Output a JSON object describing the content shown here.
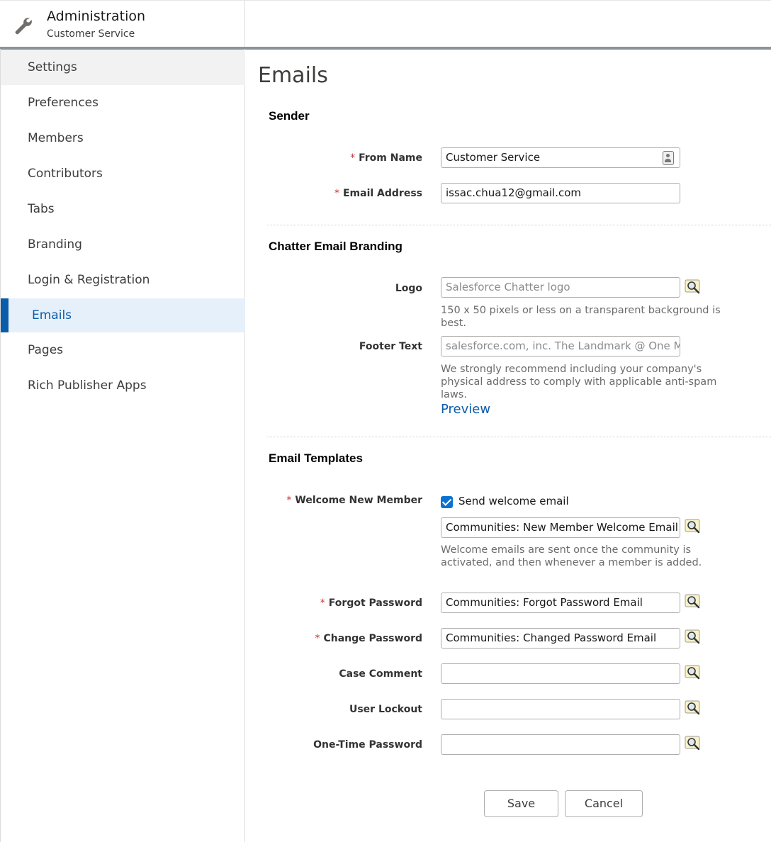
{
  "header": {
    "title": "Administration",
    "subtitle": "Customer Service"
  },
  "sidebar": {
    "items": [
      {
        "label": "Settings"
      },
      {
        "label": "Preferences"
      },
      {
        "label": "Members"
      },
      {
        "label": "Contributors"
      },
      {
        "label": "Tabs"
      },
      {
        "label": "Branding"
      },
      {
        "label": "Login & Registration"
      },
      {
        "label": "Emails"
      },
      {
        "label": "Pages"
      },
      {
        "label": "Rich Publisher Apps"
      }
    ],
    "active": "Emails"
  },
  "main": {
    "title": "Emails",
    "sender": {
      "title": "Sender",
      "from_name_label": "From Name",
      "from_name_value": "Customer Service",
      "email_label": "Email Address",
      "email_value": "issac.chua12@gmail.com"
    },
    "branding": {
      "title": "Chatter Email Branding",
      "logo_label": "Logo",
      "logo_placeholder": "Salesforce Chatter logo",
      "logo_hint": "150 x 50 pixels or less on a transparent background is best.",
      "footer_label": "Footer Text",
      "footer_placeholder": "salesforce.com, inc. The Landmark @ One Mark",
      "footer_hint": "We strongly recommend including your company's physical address to comply with applicable anti-spam laws.",
      "preview_label": "Preview"
    },
    "templates": {
      "title": "Email Templates",
      "welcome_label": "Welcome New Member",
      "welcome_checkbox_label": "Send welcome email",
      "welcome_checked": true,
      "welcome_value": "Communities: New Member Welcome Email",
      "welcome_hint": "Welcome emails are sent once the community is activated, and then whenever a member is added.",
      "forgot_label": "Forgot Password",
      "forgot_value": "Communities: Forgot Password Email",
      "change_label": "Change Password",
      "change_value": "Communities: Changed Password Email",
      "case_label": "Case Comment",
      "case_value": "",
      "lockout_label": "User Lockout",
      "lockout_value": "",
      "otp_label": "One-Time Password",
      "otp_value": ""
    },
    "required_marker": "*",
    "buttons": {
      "save": "Save",
      "cancel": "Cancel"
    }
  },
  "colors": {
    "accent": "#0b5cab",
    "required": "#c23934",
    "active_nav_bg": "#e6f0fa"
  },
  "icons": {
    "header": "wrench-icon",
    "lookup": "lookup-search-icon",
    "contact": "contact-card-icon"
  }
}
